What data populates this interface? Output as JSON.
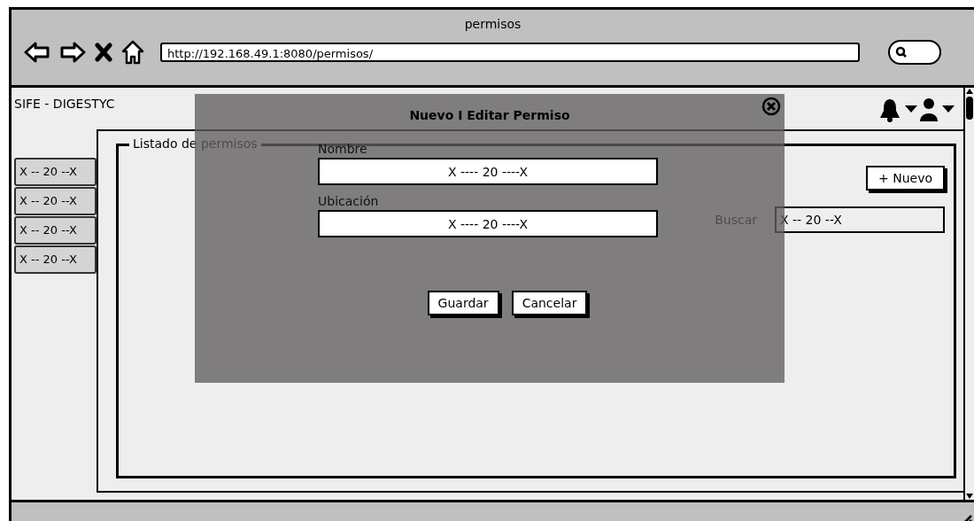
{
  "window": {
    "title": "permisos"
  },
  "browser": {
    "url": "http://192.168.49.1:8080/permisos/"
  },
  "app": {
    "brand": "SIFE - DIGESTYC"
  },
  "sidebar": {
    "items": [
      "X -- 20 --X",
      "X -- 20 --X",
      "X -- 20 --X",
      "X -- 20 --X"
    ]
  },
  "panel": {
    "legend": "Listado de permisos",
    "new_button": "+ Nuevo",
    "search": {
      "label": "Buscar",
      "value": "X -- 20 --X"
    }
  },
  "modal": {
    "title": "Nuevo I Editar Permiso",
    "fields": [
      {
        "label": "Nombre",
        "value": "X ---- 20 ----X"
      },
      {
        "label": "Ubicación",
        "value": "X ---- 20 ----X"
      }
    ],
    "buttons": [
      "Guardar",
      "Cancelar"
    ]
  }
}
